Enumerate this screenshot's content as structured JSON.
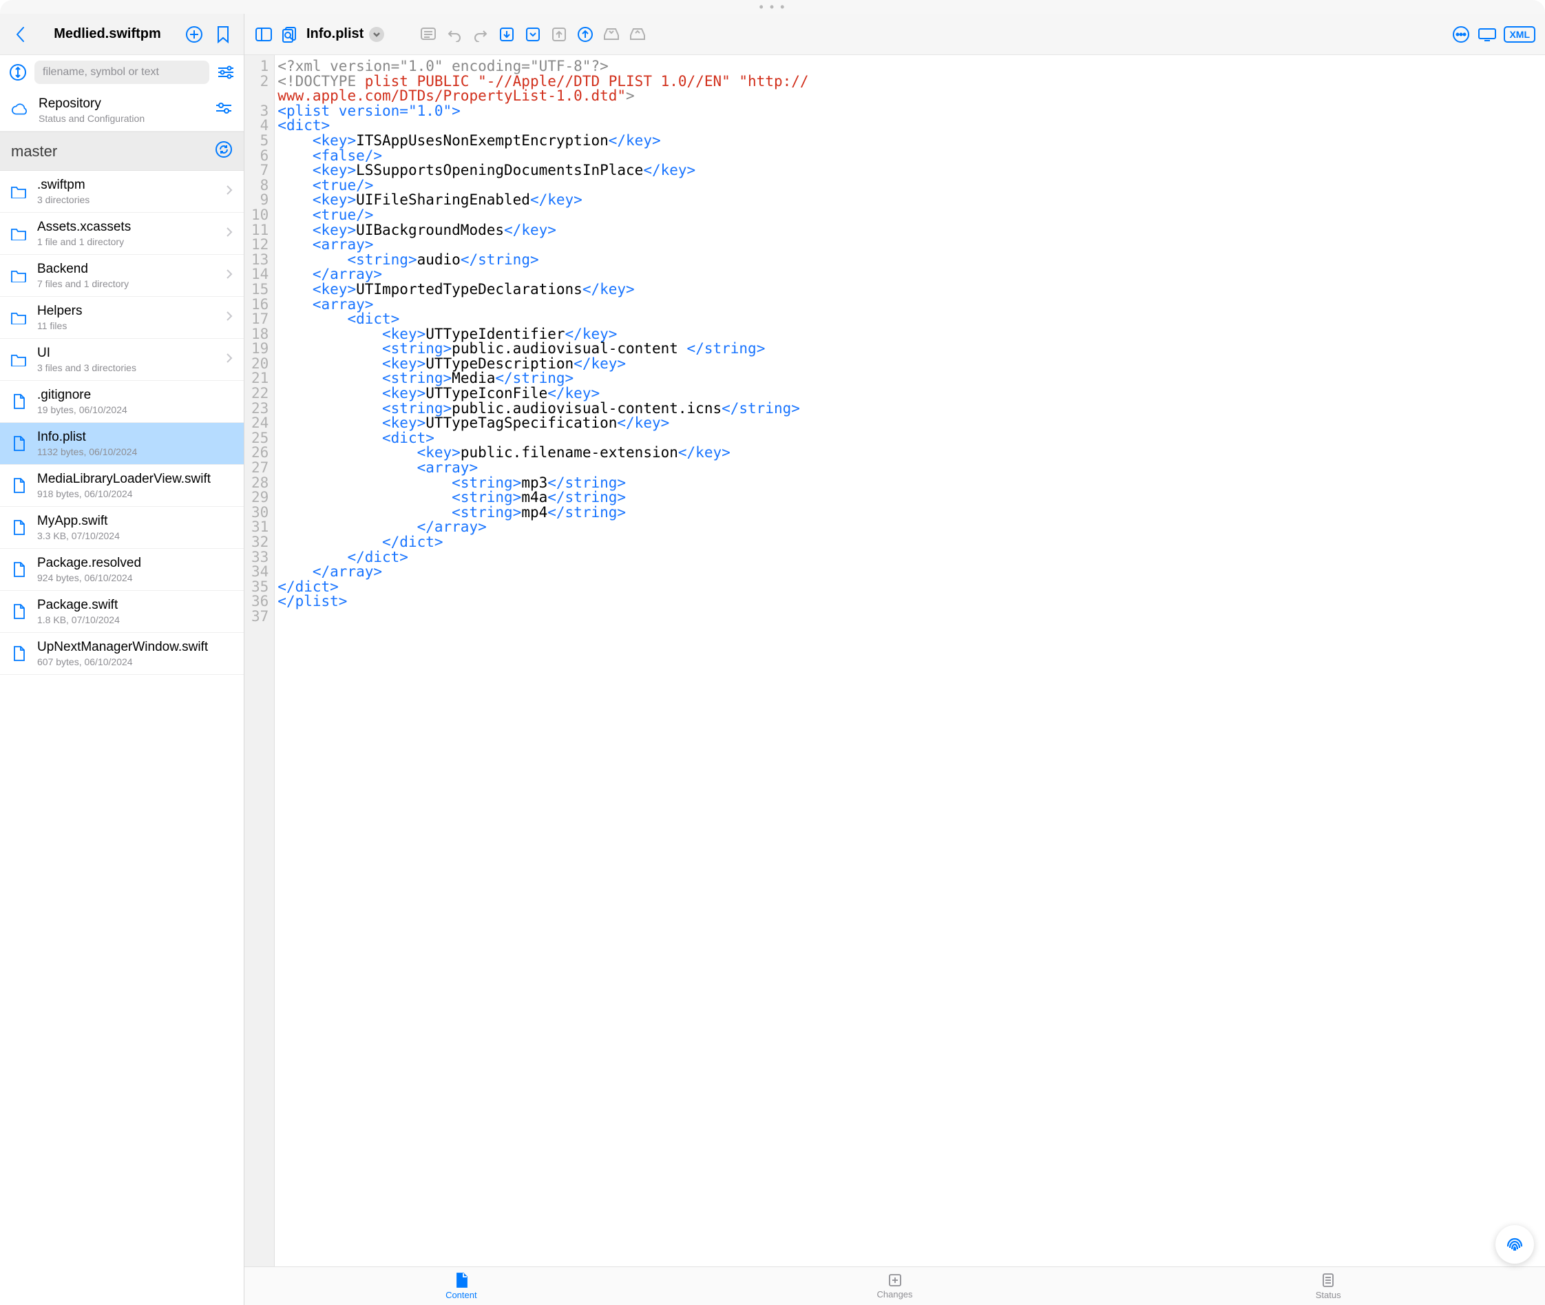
{
  "drag_handle": "• • •",
  "sidebar": {
    "title": "Medlied.swiftpm",
    "search_placeholder": "filename, symbol or text",
    "repo_row": {
      "label": "Repository",
      "sub": "Status and Configuration"
    },
    "branch": "master",
    "items": [
      {
        "icon": "folder",
        "name": ".swiftpm",
        "sub": "3 directories",
        "chevron": true
      },
      {
        "icon": "folder",
        "name": "Assets.xcassets",
        "sub": "1 file and 1 directory",
        "chevron": true
      },
      {
        "icon": "folder",
        "name": "Backend",
        "sub": "7 files and 1 directory",
        "chevron": true
      },
      {
        "icon": "folder",
        "name": "Helpers",
        "sub": "11 files",
        "chevron": true
      },
      {
        "icon": "folder",
        "name": "UI",
        "sub": "3 files and 3 directories",
        "chevron": true
      },
      {
        "icon": "file",
        "name": ".gitignore",
        "sub": "19 bytes, 06/10/2024",
        "chevron": false
      },
      {
        "icon": "file",
        "name": "Info.plist",
        "sub": "1132 bytes, 06/10/2024",
        "chevron": false,
        "selected": true
      },
      {
        "icon": "file",
        "name": "MediaLibraryLoaderView.swift",
        "sub": "918 bytes, 06/10/2024",
        "chevron": false
      },
      {
        "icon": "file",
        "name": "MyApp.swift",
        "sub": "3.3 KB, 07/10/2024",
        "chevron": false
      },
      {
        "icon": "file",
        "name": "Package.resolved",
        "sub": "924 bytes, 06/10/2024",
        "chevron": false
      },
      {
        "icon": "file",
        "name": "Package.swift",
        "sub": "1.8 KB, 07/10/2024",
        "chevron": false
      },
      {
        "icon": "file",
        "name": "UpNextManagerWindow.swift",
        "sub": "607 bytes, 06/10/2024",
        "chevron": false
      }
    ]
  },
  "toolbar": {
    "filename": "Info.plist",
    "xml_badge": "XML"
  },
  "bottom_tabs": {
    "content": "Content",
    "changes": "Changes",
    "status": "Status"
  },
  "code": {
    "lines": [
      [
        {
          "c": "t-preproc",
          "t": "<?xml version=\"1.0\" encoding=\"UTF-8\"?>"
        }
      ],
      [
        {
          "c": "t-preproc",
          "t": "<!DOCTYPE "
        },
        {
          "c": "t-red",
          "t": "plist PUBLIC \"-//Apple//DTD PLIST 1.0//EN\" \"http://"
        }
      ],
      [
        {
          "c": "",
          "t": ""
        }
      ],
      [
        {
          "c": "t-tag",
          "t": "<plist version=\"1.0\">"
        }
      ],
      [
        {
          "c": "t-tag",
          "t": "<dict>"
        }
      ],
      [
        {
          "c": "",
          "t": "    "
        },
        {
          "c": "t-tag",
          "t": "<key>"
        },
        {
          "c": "t-plain",
          "t": "ITSAppUsesNonExemptEncryption"
        },
        {
          "c": "t-tag",
          "t": "</key>"
        }
      ],
      [
        {
          "c": "",
          "t": "    "
        },
        {
          "c": "t-tag",
          "t": "<false/>"
        }
      ],
      [
        {
          "c": "",
          "t": "    "
        },
        {
          "c": "t-tag",
          "t": "<key>"
        },
        {
          "c": "t-plain",
          "t": "LSSupportsOpeningDocumentsInPlace"
        },
        {
          "c": "t-tag",
          "t": "</key>"
        }
      ],
      [
        {
          "c": "",
          "t": "    "
        },
        {
          "c": "t-tag",
          "t": "<true/>"
        }
      ],
      [
        {
          "c": "",
          "t": "    "
        },
        {
          "c": "t-tag",
          "t": "<key>"
        },
        {
          "c": "t-plain",
          "t": "UIFileSharingEnabled"
        },
        {
          "c": "t-tag",
          "t": "</key>"
        }
      ],
      [
        {
          "c": "",
          "t": "    "
        },
        {
          "c": "t-tag",
          "t": "<true/>"
        }
      ],
      [
        {
          "c": "",
          "t": "    "
        },
        {
          "c": "t-tag",
          "t": "<key>"
        },
        {
          "c": "t-plain",
          "t": "UIBackgroundModes"
        },
        {
          "c": "t-tag",
          "t": "</key>"
        }
      ],
      [
        {
          "c": "",
          "t": "    "
        },
        {
          "c": "t-tag",
          "t": "<array>"
        }
      ],
      [
        {
          "c": "",
          "t": "        "
        },
        {
          "c": "t-tag",
          "t": "<string>"
        },
        {
          "c": "t-plain",
          "t": "audio"
        },
        {
          "c": "t-tag",
          "t": "</string>"
        }
      ],
      [
        {
          "c": "",
          "t": "    "
        },
        {
          "c": "t-tag",
          "t": "</array>"
        }
      ],
      [
        {
          "c": "",
          "t": "    "
        },
        {
          "c": "t-tag",
          "t": "<key>"
        },
        {
          "c": "t-plain",
          "t": "UTImportedTypeDeclarations"
        },
        {
          "c": "t-tag",
          "t": "</key>"
        }
      ],
      [
        {
          "c": "",
          "t": "    "
        },
        {
          "c": "t-tag",
          "t": "<array>"
        }
      ],
      [
        {
          "c": "",
          "t": "        "
        },
        {
          "c": "t-tag",
          "t": "<dict>"
        }
      ],
      [
        {
          "c": "",
          "t": "            "
        },
        {
          "c": "t-tag",
          "t": "<key>"
        },
        {
          "c": "t-plain",
          "t": "UTTypeIdentifier"
        },
        {
          "c": "t-tag",
          "t": "</key>"
        }
      ],
      [
        {
          "c": "",
          "t": "            "
        },
        {
          "c": "t-tag",
          "t": "<string>"
        },
        {
          "c": "t-plain",
          "t": "public.audiovisual-content "
        },
        {
          "c": "t-tag",
          "t": "</string>"
        }
      ],
      [
        {
          "c": "",
          "t": "            "
        },
        {
          "c": "t-tag",
          "t": "<key>"
        },
        {
          "c": "t-plain",
          "t": "UTTypeDescription"
        },
        {
          "c": "t-tag",
          "t": "</key>"
        }
      ],
      [
        {
          "c": "",
          "t": "            "
        },
        {
          "c": "t-tag",
          "t": "<string>"
        },
        {
          "c": "t-plain",
          "t": "Media"
        },
        {
          "c": "t-tag",
          "t": "</string>"
        }
      ],
      [
        {
          "c": "",
          "t": "            "
        },
        {
          "c": "t-tag",
          "t": "<key>"
        },
        {
          "c": "t-plain",
          "t": "UTTypeIconFile"
        },
        {
          "c": "t-tag",
          "t": "</key>"
        }
      ],
      [
        {
          "c": "",
          "t": "            "
        },
        {
          "c": "t-tag",
          "t": "<string>"
        },
        {
          "c": "t-plain",
          "t": "public.audiovisual-content.icns"
        },
        {
          "c": "t-tag",
          "t": "</string>"
        }
      ],
      [
        {
          "c": "",
          "t": "            "
        },
        {
          "c": "t-tag",
          "t": "<key>"
        },
        {
          "c": "t-plain",
          "t": "UTTypeTagSpecification"
        },
        {
          "c": "t-tag",
          "t": "</key>"
        }
      ],
      [
        {
          "c": "",
          "t": "            "
        },
        {
          "c": "t-tag",
          "t": "<dict>"
        }
      ],
      [
        {
          "c": "",
          "t": "                "
        },
        {
          "c": "t-tag",
          "t": "<key>"
        },
        {
          "c": "t-plain",
          "t": "public.filename-extension"
        },
        {
          "c": "t-tag",
          "t": "</key>"
        }
      ],
      [
        {
          "c": "",
          "t": "                "
        },
        {
          "c": "t-tag",
          "t": "<array>"
        }
      ],
      [
        {
          "c": "",
          "t": "                    "
        },
        {
          "c": "t-tag",
          "t": "<string>"
        },
        {
          "c": "t-plain",
          "t": "mp3"
        },
        {
          "c": "t-tag",
          "t": "</string>"
        }
      ],
      [
        {
          "c": "",
          "t": "                    "
        },
        {
          "c": "t-tag",
          "t": "<string>"
        },
        {
          "c": "t-plain",
          "t": "m4a"
        },
        {
          "c": "t-tag",
          "t": "</string>"
        }
      ],
      [
        {
          "c": "",
          "t": "                    "
        },
        {
          "c": "t-tag",
          "t": "<string>"
        },
        {
          "c": "t-plain",
          "t": "mp4"
        },
        {
          "c": "t-tag",
          "t": "</string>"
        }
      ],
      [
        {
          "c": "",
          "t": "                "
        },
        {
          "c": "t-tag",
          "t": "</array>"
        }
      ],
      [
        {
          "c": "",
          "t": "            "
        },
        {
          "c": "t-tag",
          "t": "</dict>"
        }
      ],
      [
        {
          "c": "",
          "t": "        "
        },
        {
          "c": "t-tag",
          "t": "</dict>"
        }
      ],
      [
        {
          "c": "",
          "t": "    "
        },
        {
          "c": "t-tag",
          "t": "</array>"
        }
      ],
      [
        {
          "c": "t-tag",
          "t": "</dict>"
        }
      ],
      [
        {
          "c": "t-tag",
          "t": "</plist>"
        }
      ],
      [
        {
          "c": "",
          "t": ""
        }
      ]
    ],
    "wrap_line_index": 1,
    "wrap_continuation": "www.apple.com/DTDs/PropertyList-1.0.dtd\"",
    "wrap_tail": ">",
    "line_numbers": [
      1,
      2,
      "",
      3,
      4,
      5,
      6,
      7,
      8,
      9,
      10,
      11,
      12,
      13,
      14,
      15,
      16,
      17,
      18,
      19,
      20,
      21,
      22,
      23,
      24,
      25,
      26,
      27,
      28,
      29,
      30,
      31,
      32,
      33,
      34,
      35,
      36,
      37
    ]
  }
}
